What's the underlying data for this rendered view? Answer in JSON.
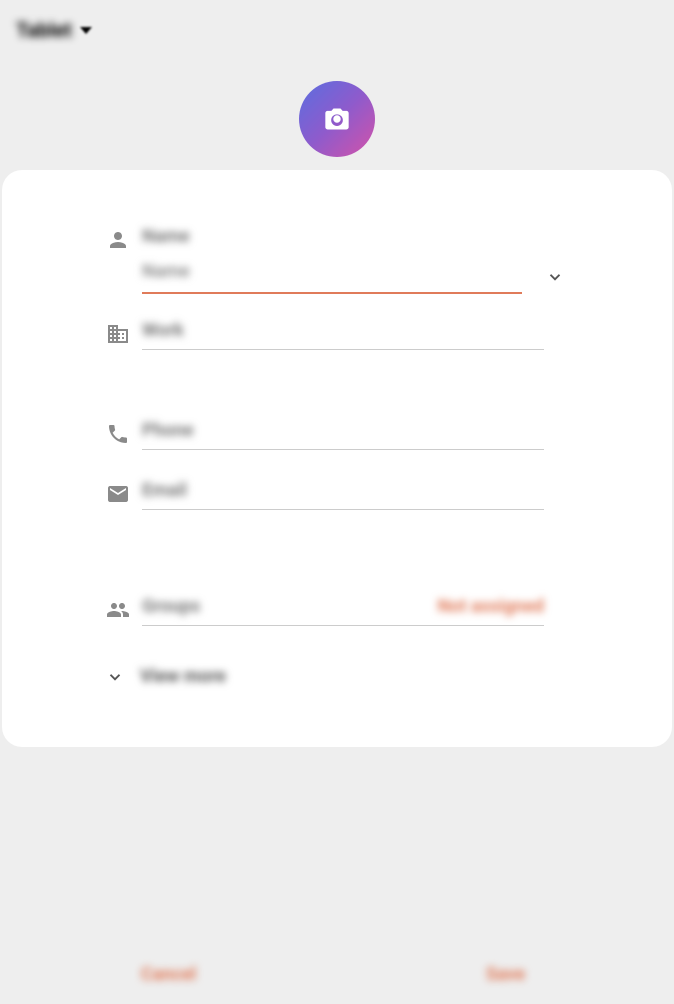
{
  "header": {
    "title": "Tablet"
  },
  "fields": {
    "name": {
      "label": "Name",
      "placeholder": "Name"
    },
    "work": {
      "label": "Work"
    },
    "phone": {
      "label": "Phone"
    },
    "email": {
      "label": "Email"
    },
    "groups": {
      "label": "Groups",
      "value": "Not assigned"
    },
    "viewMore": "View more"
  },
  "actions": {
    "cancel": "Cancel",
    "save": "Save"
  },
  "colors": {
    "accent": "#e07b5a",
    "avatarGradientStart": "#5a6ee0",
    "avatarGradientEnd": "#d452a8"
  }
}
